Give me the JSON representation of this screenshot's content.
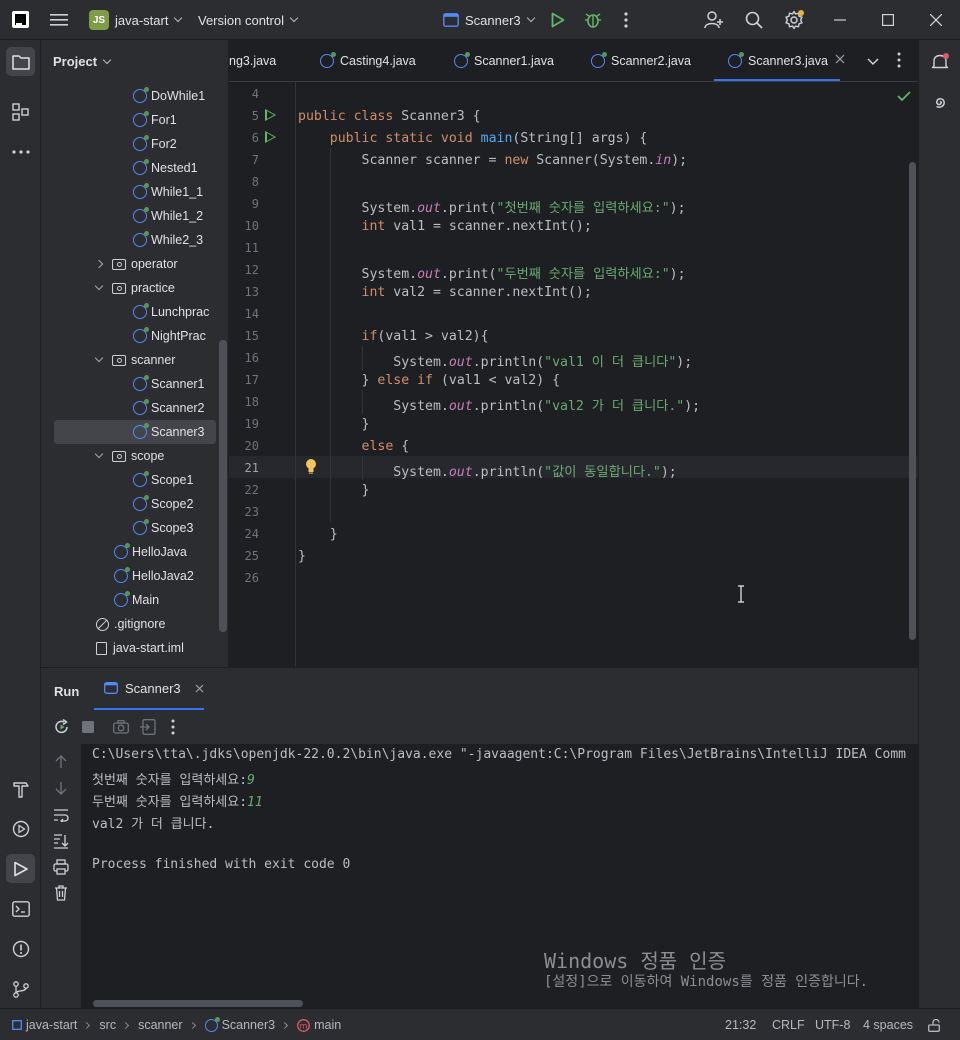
{
  "titlebar": {
    "project_badge": "JS",
    "project_name": "java-start",
    "vcs_label": "Version control",
    "run_config": "Scanner3"
  },
  "project_panel": {
    "title": "Project",
    "tree": [
      {
        "label": "DoWhile1",
        "type": "class"
      },
      {
        "label": "For1",
        "type": "class"
      },
      {
        "label": "For2",
        "type": "class"
      },
      {
        "label": "Nested1",
        "type": "class"
      },
      {
        "label": "While1_1",
        "type": "class"
      },
      {
        "label": "While1_2",
        "type": "class"
      },
      {
        "label": "While2_3",
        "type": "class"
      },
      {
        "label": "operator",
        "type": "package-collapsed"
      },
      {
        "label": "practice",
        "type": "package-expanded"
      },
      {
        "label": "Lunchprac",
        "type": "class"
      },
      {
        "label": "NightPrac",
        "type": "class"
      },
      {
        "label": "scanner",
        "type": "package-expanded"
      },
      {
        "label": "Scanner1",
        "type": "class"
      },
      {
        "label": "Scanner2",
        "type": "class"
      },
      {
        "label": "Scanner3",
        "type": "class",
        "selected": true
      },
      {
        "label": "scope",
        "type": "package-expanded"
      },
      {
        "label": "Scope1",
        "type": "class"
      },
      {
        "label": "Scope2",
        "type": "class"
      },
      {
        "label": "Scope3",
        "type": "class"
      },
      {
        "label": "HelloJava",
        "type": "class"
      },
      {
        "label": "HelloJava2",
        "type": "class"
      },
      {
        "label": "Main",
        "type": "class"
      },
      {
        "label": ".gitignore",
        "type": "ignore"
      },
      {
        "label": "java-start.iml",
        "type": "file"
      }
    ]
  },
  "tabs": [
    {
      "label": "ng3.java",
      "icon": false
    },
    {
      "label": "Casting4.java",
      "icon": true
    },
    {
      "label": "Scanner1.java",
      "icon": true
    },
    {
      "label": "Scanner2.java",
      "icon": true
    },
    {
      "label": "Scanner3.java",
      "icon": true,
      "active": true
    }
  ],
  "editor": {
    "line_numbers": [
      "4",
      "5",
      "6",
      "7",
      "8",
      "9",
      "10",
      "11",
      "12",
      "13",
      "14",
      "15",
      "16",
      "17",
      "18",
      "19",
      "20",
      "21",
      "22",
      "23",
      "24",
      "25",
      "26"
    ],
    "lines": [
      [],
      [
        [
          "kw",
          "public class "
        ],
        [
          "",
          "Scanner3 {"
        ]
      ],
      [
        [
          "",
          "    "
        ],
        [
          "kw",
          "public static void "
        ],
        [
          "mth",
          "main"
        ],
        [
          "",
          "(String[] args) {"
        ]
      ],
      [
        [
          "",
          "        Scanner scanner = "
        ],
        [
          "kw",
          "new "
        ],
        [
          "",
          "Scanner(System."
        ],
        [
          "fld",
          "in"
        ],
        [
          "",
          ");"
        ]
      ],
      [],
      [
        [
          "",
          "        System."
        ],
        [
          "fld",
          "out"
        ],
        [
          "",
          ".print("
        ],
        [
          "str",
          "\"첫번째 숫자를 입력하세요:\""
        ],
        [
          "",
          ");"
        ]
      ],
      [
        [
          "kw",
          "        int "
        ],
        [
          "",
          "val1 = scanner.nextInt();"
        ]
      ],
      [],
      [
        [
          "",
          "        System."
        ],
        [
          "fld",
          "out"
        ],
        [
          "",
          ".print("
        ],
        [
          "str",
          "\"두번째 숫자를 입력하세요:\""
        ],
        [
          "",
          ");"
        ]
      ],
      [
        [
          "kw",
          "        int "
        ],
        [
          "",
          "val2 = scanner.nextInt();"
        ]
      ],
      [],
      [
        [
          "kw",
          "        if"
        ],
        [
          "",
          "(val1 > val2){"
        ]
      ],
      [
        [
          "",
          "            System."
        ],
        [
          "fld",
          "out"
        ],
        [
          "",
          ".println("
        ],
        [
          "str",
          "\"val1 이 더 큽니다\""
        ],
        [
          "",
          ");"
        ]
      ],
      [
        [
          "",
          "        } "
        ],
        [
          "kw",
          "else if "
        ],
        [
          "",
          "(val1 < val2) {"
        ]
      ],
      [
        [
          "",
          "            System."
        ],
        [
          "fld",
          "out"
        ],
        [
          "",
          ".println("
        ],
        [
          "str",
          "\"val2 가 더 큽니다.\""
        ],
        [
          "",
          ");"
        ]
      ],
      [
        [
          "",
          "        }"
        ]
      ],
      [
        [
          "kw",
          "        else "
        ],
        [
          "",
          "{"
        ]
      ],
      [
        [
          "",
          "            System."
        ],
        [
          "fld",
          "out"
        ],
        [
          "",
          ".println("
        ],
        [
          "str",
          "\"값이 동일합니다.\""
        ],
        [
          "",
          ");"
        ]
      ],
      [
        [
          "",
          "        }"
        ]
      ],
      [],
      [
        [
          "",
          "    }"
        ]
      ],
      [
        [
          "",
          "}"
        ]
      ],
      []
    ]
  },
  "run_panel": {
    "title": "Run",
    "tab_label": "Scanner3",
    "console": [
      [
        [
          "",
          "C:\\Users\\tta\\.jdks\\openjdk-22.0.2\\bin\\java.exe \"-javaagent:C:\\Program Files\\JetBrains\\IntelliJ IDEA Comm"
        ]
      ],
      [
        [
          "",
          "첫번째 숫자를 입력하세요:"
        ],
        [
          "user-in",
          "9"
        ]
      ],
      [
        [
          "",
          "두번째 숫자를 입력하세요:"
        ],
        [
          "user-in",
          "11"
        ]
      ],
      [
        [
          "",
          "val2 가 더 큽니다."
        ]
      ],
      [
        [
          "",
          ""
        ]
      ],
      [
        [
          "",
          "Process finished with exit code 0"
        ]
      ]
    ],
    "watermark_title": "Windows 정품 인증",
    "watermark_sub": "[설정]으로 이동하여 Windows를 정품 인증합니다."
  },
  "statusbar": {
    "breadcrumbs": [
      "java-start",
      "src",
      "scanner",
      "Scanner3",
      "main"
    ],
    "position": "21:32",
    "line_sep": "CRLF",
    "encoding": "UTF-8",
    "indent": "4 spaces"
  },
  "colors": {
    "accent": "#3574f0",
    "run_green": "#5fb865",
    "debug_green": "#57965c"
  }
}
